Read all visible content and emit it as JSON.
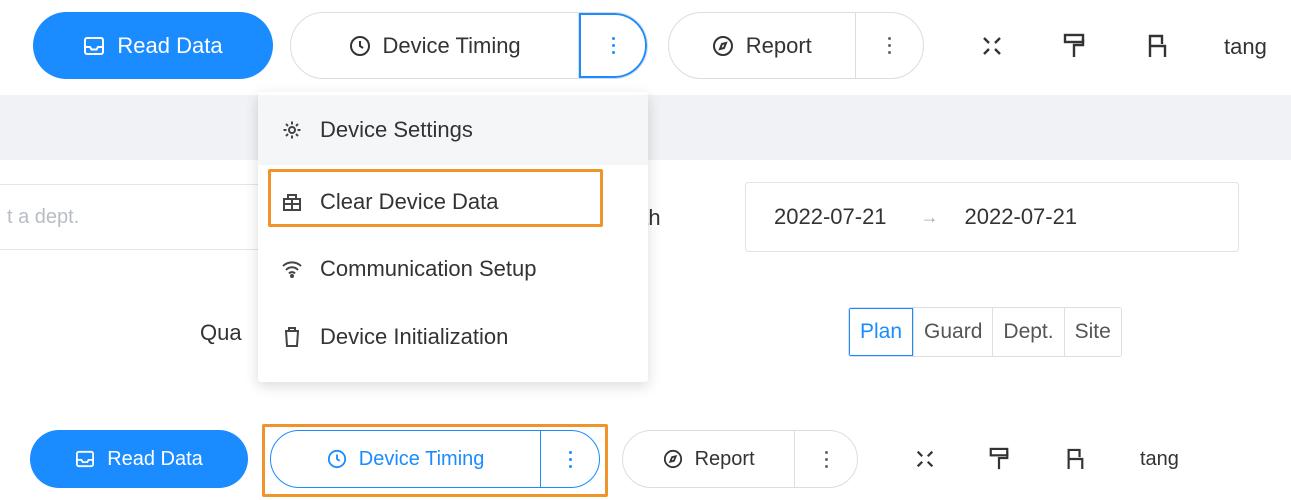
{
  "toolbar": {
    "read_data": "Read Data",
    "device_timing": "Device Timing",
    "report": "Report",
    "username": "tang"
  },
  "filters": {
    "dept_placeholder": "t a dept.",
    "month_label": "nth",
    "date_start": "2022-07-21",
    "date_end": "2022-07-21",
    "date_separator": "→",
    "qua_label": "Qua",
    "segments": [
      "Plan",
      "Guard",
      "Dept.",
      "Site"
    ]
  },
  "dropdown": {
    "items": [
      {
        "label": "Device Settings",
        "icon": "gear-icon"
      },
      {
        "label": "Clear Device Data",
        "icon": "database-icon"
      },
      {
        "label": "Communication Setup",
        "icon": "wifi-icon"
      },
      {
        "label": "Device Initialization",
        "icon": "trash-icon"
      }
    ]
  },
  "colors": {
    "primary": "#1a8cff",
    "highlight": "#f0932b",
    "band": "#f0f2f5"
  }
}
